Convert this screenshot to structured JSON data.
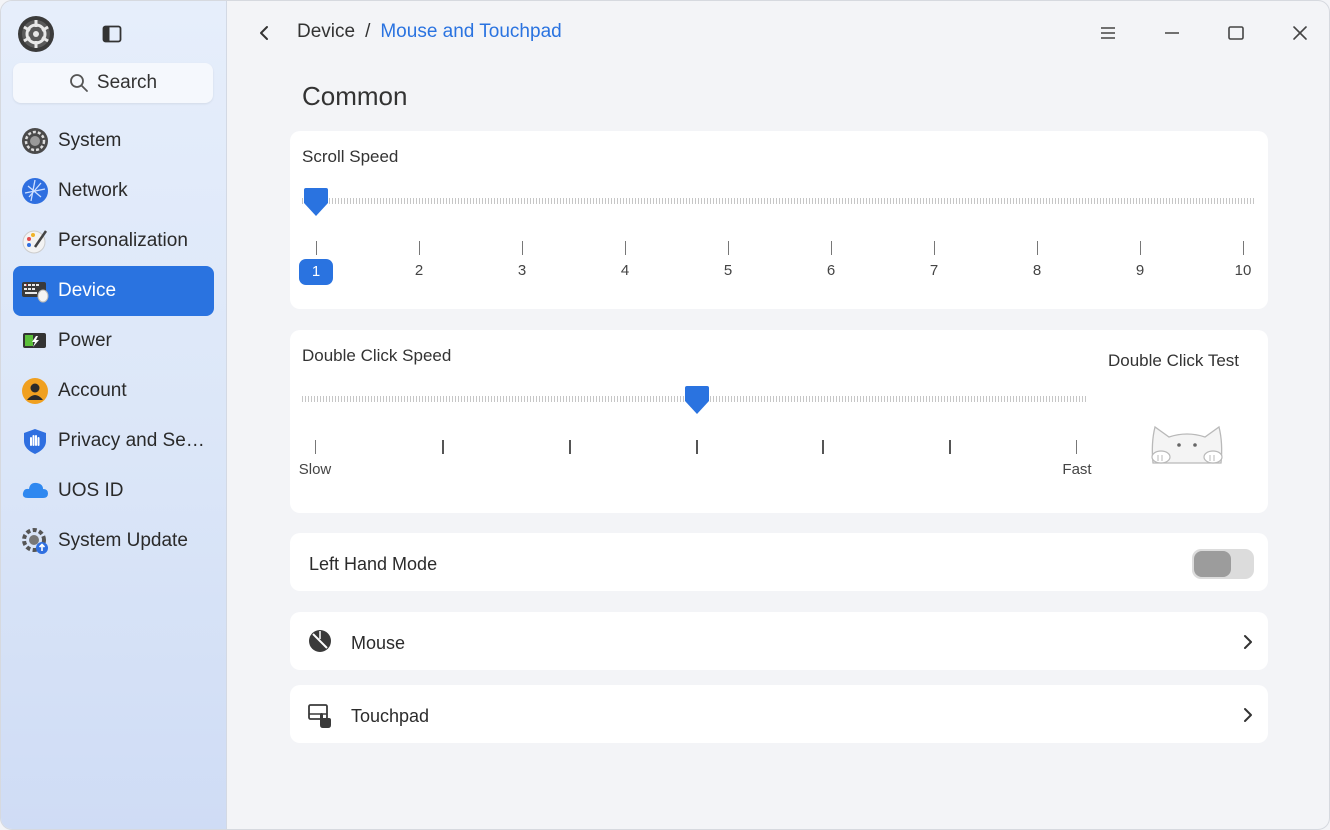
{
  "sidebar": {
    "search_label": "Search",
    "items": [
      {
        "label": "System",
        "icon": "system-icon"
      },
      {
        "label": "Network",
        "icon": "network-icon"
      },
      {
        "label": "Personalization",
        "icon": "personalization-icon"
      },
      {
        "label": "Device",
        "icon": "device-icon",
        "active": true
      },
      {
        "label": "Power",
        "icon": "power-icon"
      },
      {
        "label": "Account",
        "icon": "account-icon"
      },
      {
        "label": "Privacy and Sec…",
        "icon": "privacy-icon"
      },
      {
        "label": "UOS ID",
        "icon": "cloud-icon"
      },
      {
        "label": "System Update",
        "icon": "system-update-icon"
      }
    ]
  },
  "header": {
    "breadcrumb_parent": "Device",
    "breadcrumb_separator": "/",
    "breadcrumb_current": "Mouse and Touchpad"
  },
  "main": {
    "section_title": "Common",
    "scroll_speed": {
      "label": "Scroll Speed",
      "ticks": [
        "1",
        "2",
        "3",
        "4",
        "5",
        "6",
        "7",
        "8",
        "9",
        "10"
      ],
      "value": 1
    },
    "double_click": {
      "label": "Double Click Speed",
      "test_label": "Double Click Test",
      "min_label": "Slow",
      "max_label": "Fast",
      "tick_count": 7,
      "value_fraction": 0.5
    },
    "left_hand_mode": {
      "label": "Left Hand Mode",
      "enabled": false
    },
    "links": [
      {
        "label": "Mouse",
        "icon": "mouse-icon"
      },
      {
        "label": "Touchpad",
        "icon": "touchpad-icon"
      }
    ]
  },
  "colors": {
    "accent": "#2a73e0",
    "sidebar_bg": "#dbe6f8",
    "content_bg": "#f3f4f7",
    "card_bg": "#ffffff"
  }
}
